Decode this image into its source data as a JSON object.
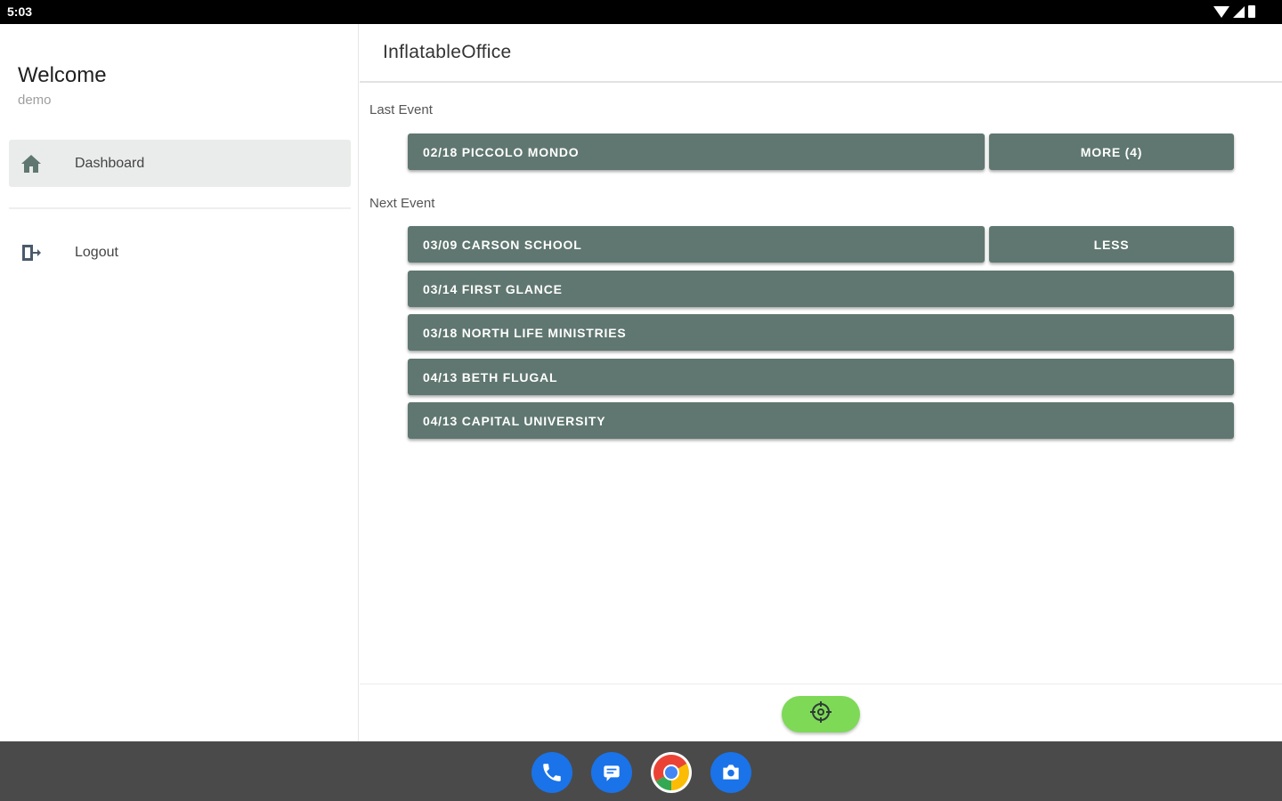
{
  "status_bar": {
    "time": "5:03",
    "icons": [
      "wifi-icon",
      "signal-icon",
      "battery-icon"
    ]
  },
  "drawer": {
    "welcome": "Welcome",
    "username": "demo",
    "items": [
      {
        "label": "Dashboard",
        "icon": "home-icon",
        "active": true
      },
      {
        "label": "Logout",
        "icon": "logout-icon",
        "active": false
      }
    ]
  },
  "appbar": {
    "title": "InflatableOffice"
  },
  "last_event": {
    "label": "Last Event",
    "event": "02/18 PICCOLO MONDO",
    "more_button": "MORE (4)"
  },
  "next_event": {
    "label": "Next Event",
    "first_event": "03/09 CARSON SCHOOL",
    "less_button": "LESS",
    "events": [
      "03/14 FIRST GLANCE",
      "03/18 NORTH LIFE MINISTRIES",
      "04/13 BETH FLUGAL",
      "04/13 CAPITAL UNIVERSITY"
    ]
  },
  "fab": {
    "icon": "crosshair-icon"
  },
  "dock": {
    "apps": [
      "phone-icon",
      "messages-icon",
      "chrome-icon",
      "camera-icon"
    ]
  },
  "colors": {
    "button_bg": "#5f7770",
    "fab_bg": "#7ed957",
    "active_nav_bg": "#e9ecea",
    "dock_bg": "#4a4a4a",
    "app_icon_blue": "#1a73e8"
  }
}
